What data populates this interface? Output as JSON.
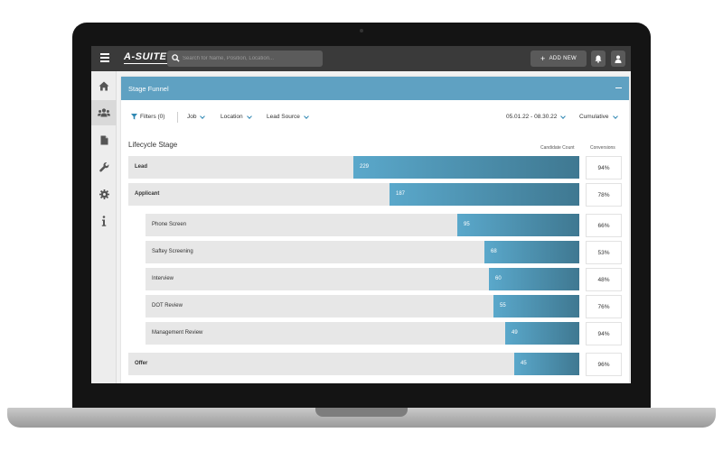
{
  "app": {
    "logo": "A-SUITE",
    "search_placeholder": "Search for Name, Position, Location...",
    "add_new_label": "ADD NEW",
    "icons": [
      "menu-icon",
      "search-icon",
      "bell-icon",
      "user-icon"
    ]
  },
  "sidebar": {
    "items": [
      {
        "icon": "home-icon",
        "active": false
      },
      {
        "icon": "users-icon",
        "active": true
      },
      {
        "icon": "document-icon",
        "active": false
      },
      {
        "icon": "wrench-icon",
        "active": false
      },
      {
        "icon": "gear-icon",
        "active": false
      },
      {
        "icon": "info-icon",
        "active": false
      }
    ]
  },
  "card": {
    "title": "Stage Funnel",
    "filters": {
      "filters_label": "Filters (0)",
      "job_label": "Job",
      "location_label": "Location",
      "lead_source_label": "Lead Source",
      "date_range": "05.01.22 - 08.30.22",
      "mode": "Cumulative"
    },
    "section_title": "Lifecycle Stage",
    "col_candidate_count": "Candidate Count",
    "col_conversions": "Conversions",
    "stages": [
      {
        "name": "Lead",
        "count": "229",
        "fraction": 0.5,
        "conversion": "94%",
        "level": 0
      },
      {
        "name": "Applicant",
        "count": "187",
        "fraction": 0.42,
        "conversion": "78%",
        "level": 0
      },
      {
        "name": "Phone Screen",
        "count": "95",
        "fraction": 0.27,
        "conversion": "66%",
        "level": 1
      },
      {
        "name": "Saftey Screening",
        "count": "68",
        "fraction": 0.21,
        "conversion": "53%",
        "level": 1
      },
      {
        "name": "Interview",
        "count": "60",
        "fraction": 0.2,
        "conversion": "48%",
        "level": 1
      },
      {
        "name": "DOT Review",
        "count": "55",
        "fraction": 0.19,
        "conversion": "76%",
        "level": 1
      },
      {
        "name": "Management Review",
        "count": "49",
        "fraction": 0.165,
        "conversion": "94%",
        "level": 1
      },
      {
        "name": "Offer",
        "count": "45",
        "fraction": 0.145,
        "conversion": "96%",
        "level": 0
      }
    ]
  },
  "colors": {
    "header_blue": "#5fa1c2",
    "bar_start": "#5aa8cb",
    "bar_end": "#3f7891",
    "topbar": "#3a3a3a"
  }
}
